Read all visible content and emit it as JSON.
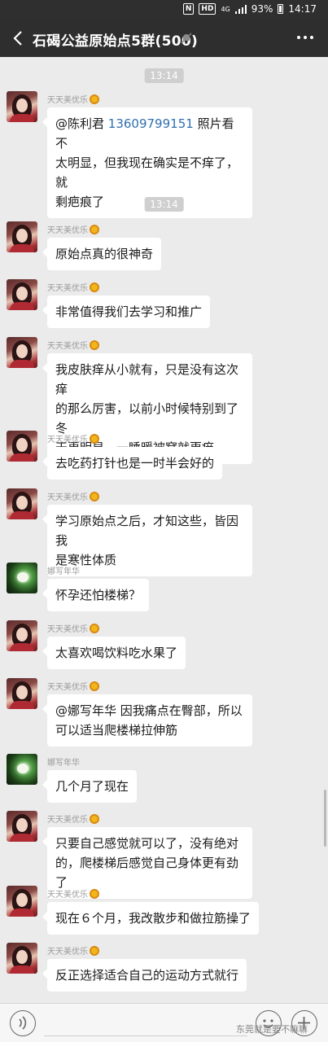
{
  "status_bar": {
    "nfc": "N",
    "hd": "HD",
    "network": "4G",
    "battery": "93%",
    "time": "14:17"
  },
  "header": {
    "title": "石碣公益原始点5群(500)"
  },
  "timestamps": [
    "13:14",
    "13:14"
  ],
  "nicknames": {
    "a": "天天美优乐",
    "b": "娜写年华"
  },
  "messages": [
    {
      "lines": [
        "@陈利君",
        "13609799151",
        "照片看不",
        "太明显，但我现在确实是不痒了，就",
        "剩疤痕了"
      ]
    },
    {
      "text": "原始点真的很神奇"
    },
    {
      "text": "非常值得我们去学习和推广"
    },
    {
      "lines": [
        "我皮肤痒从小就有，只是没有这次痒",
        "的那么厉害，以前小时候特别到了冬",
        "天更明显，一睡暖被窝就更痒"
      ]
    },
    {
      "text": "去吃药打针也是一时半会好的"
    },
    {
      "lines": [
        "学习原始点之后，才知这些，皆因我",
        "是寒性体质"
      ]
    },
    {
      "text": "怀孕还怕楼梯？"
    },
    {
      "text": "太喜欢喝饮料吃水果了"
    },
    {
      "lines": [
        "@娜写年华  因我痛点在臀部，所以",
        "可以适当爬楼梯拉伸筋"
      ]
    },
    {
      "text": "几个月了现在"
    },
    {
      "lines": [
        "只要自己感觉就可以了，没有绝对",
        "的，爬楼梯后感觉自己身体更有劲了"
      ]
    },
    {
      "text": "现在６个月，我改散步和做拉筋操了"
    },
    {
      "text": "反正选择适合自己的运动方式就行"
    }
  ],
  "footer": {
    "watermark": "东莞就是要不嘛嘛"
  },
  "colors": {
    "title_bar": "#2e2e2e",
    "chat_bg": "#ebebeb",
    "link": "#2f6fb0"
  },
  "icons": [
    "back-icon",
    "mute-icon",
    "more-icon",
    "sun-icon",
    "voice-icon",
    "emoji-icon",
    "plus-icon"
  ]
}
